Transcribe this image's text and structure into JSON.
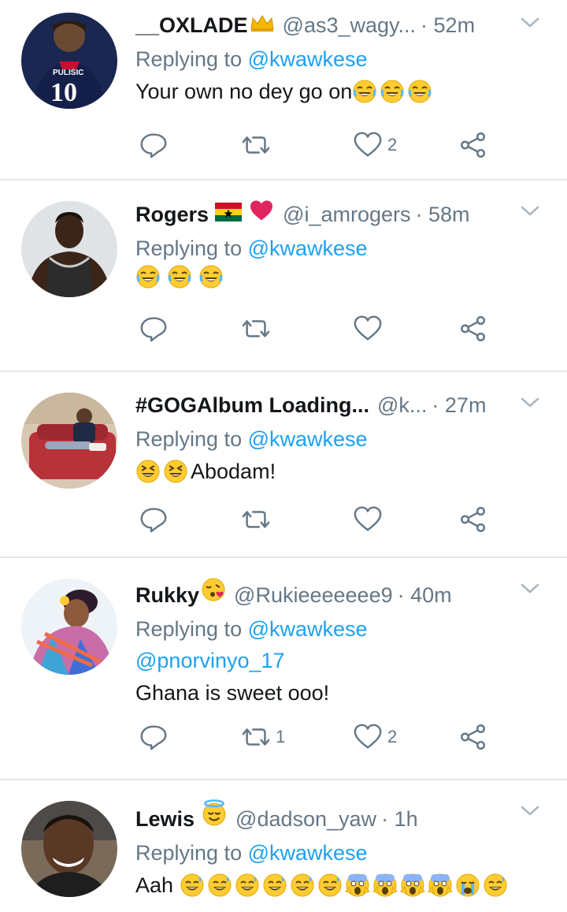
{
  "reply_prefix": "Replying to",
  "tweets": [
    {
      "name": "__OXLADE",
      "handle": "@as3_wagy...",
      "time": "· 52m",
      "reply_to": "@kwawkese",
      "text": "Your own no dey go on",
      "emojis": [
        "face-with-tears-of-joy-icon",
        "face-with-tears-of-joy-icon",
        "face-with-tears-of-joy-icon"
      ],
      "reply_count": "",
      "retweet_count": "",
      "like_count": "2",
      "avatar_jersey": "PULISIC",
      "avatar_number": "10"
    },
    {
      "name": "Rogers",
      "handle": "@i_amrogers",
      "time": "· 58m",
      "reply_to": "@kwawkese",
      "text": "",
      "emojis": [
        "face-with-tears-of-joy-icon",
        "face-with-tears-of-joy-icon",
        "face-with-tears-of-joy-icon"
      ],
      "reply_count": "",
      "retweet_count": "",
      "like_count": ""
    },
    {
      "name": "#GOGAlbum Loading...",
      "handle": "@k...",
      "time": "· 27m",
      "reply_to": "@kwawkese",
      "text": "Abodam!",
      "emojis": [
        "squinting-face-icon",
        "squinting-face-icon"
      ],
      "reply_count": "",
      "retweet_count": "",
      "like_count": ""
    },
    {
      "name": "Rukky",
      "handle": "@Rukieeeeeee9",
      "time": "· 40m",
      "reply_to": "@kwawkese",
      "mention": "@pnorvinyo_17",
      "text": "Ghana is sweet ooo!",
      "reply_count": "",
      "retweet_count": "1",
      "like_count": "2"
    },
    {
      "name": "Lewis",
      "handle": "@dadson_yaw",
      "time": "· 1h",
      "reply_to": "@kwawkese",
      "text": "Aah",
      "emojis": [
        "grinning-sweat-icon",
        "grinning-sweat-icon",
        "grinning-sweat-icon",
        "grinning-sweat-icon",
        "grinning-sweat-icon",
        "grinning-sweat-icon",
        "screaming-face-icon",
        "screaming-face-icon",
        "screaming-face-icon",
        "screaming-face-icon",
        "crying-face-icon",
        "grinning-sweat-icon"
      ]
    }
  ],
  "colors": {
    "accent": "#1da1f2",
    "secondary_text": "#657786",
    "divider": "#e1e8ed"
  }
}
